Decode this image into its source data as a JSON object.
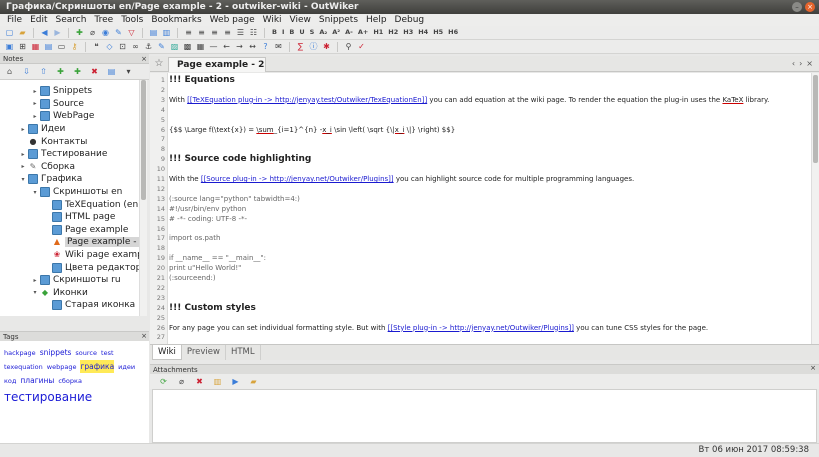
{
  "window": {
    "title": "Графика/Скриншоты en/Page example - 2 - outwiker-wiki - OutWiker"
  },
  "menu": [
    "File",
    "Edit",
    "Search",
    "Tree",
    "Tools",
    "Bookmarks",
    "Web page",
    "Wiki",
    "View",
    "Snippets",
    "Help",
    "Debug"
  ],
  "toolbar": {
    "format_labels": [
      "B",
      "I",
      "B",
      "U",
      "S",
      "A₂",
      "A²",
      "A-",
      "A+",
      "H1",
      "H2",
      "H3",
      "H4",
      "H5",
      "H6"
    ]
  },
  "notes_panel": {
    "title": "Notes",
    "tree": [
      {
        "label": "Snippets",
        "depth": 2,
        "arrow": "▸",
        "icon": "page"
      },
      {
        "label": "Source",
        "depth": 2,
        "arrow": "▸",
        "icon": "page"
      },
      {
        "label": "WebPage",
        "depth": 2,
        "arrow": "▸",
        "icon": "page"
      },
      {
        "label": "Идеи",
        "depth": 1,
        "arrow": "▸",
        "icon": "page"
      },
      {
        "label": "Контакты",
        "depth": 1,
        "arrow": "",
        "icon": "person"
      },
      {
        "label": "Тестирование",
        "depth": 1,
        "arrow": "▸",
        "icon": "page"
      },
      {
        "label": "Сборка",
        "depth": 1,
        "arrow": "▸",
        "icon": "wrench"
      },
      {
        "label": "Графика",
        "depth": 1,
        "arrow": "▾",
        "icon": "page"
      },
      {
        "label": "Скриншоты en",
        "depth": 2,
        "arrow": "▾",
        "icon": "page"
      },
      {
        "label": "TeXEquation (en)",
        "depth": 3,
        "arrow": "",
        "icon": "page"
      },
      {
        "label": "HTML page",
        "depth": 3,
        "arrow": "",
        "icon": "page"
      },
      {
        "label": "Page example",
        "depth": 3,
        "arrow": "",
        "icon": "page"
      },
      {
        "label": "Page example - 2",
        "depth": 3,
        "arrow": "",
        "icon": "warning",
        "selected": true
      },
      {
        "label": "Wiki page example",
        "depth": 3,
        "arrow": "",
        "icon": "wiki"
      },
      {
        "label": "Цвета редактора",
        "depth": 3,
        "arrow": "",
        "icon": "page"
      },
      {
        "label": "Скриншоты ru",
        "depth": 2,
        "arrow": "▸",
        "icon": "page"
      },
      {
        "label": "Иконки",
        "depth": 2,
        "arrow": "▾",
        "icon": "images"
      },
      {
        "label": "Старая иконка",
        "depth": 3,
        "arrow": "",
        "icon": "page"
      }
    ]
  },
  "tags_panel": {
    "title": "Tags",
    "tags": [
      {
        "label": "hackpage",
        "size": "sm"
      },
      {
        "label": "snippets",
        "size": "md"
      },
      {
        "label": "source",
        "size": "sm"
      },
      {
        "label": "test",
        "size": "sm"
      },
      {
        "label": "texequation",
        "size": "sm"
      },
      {
        "label": "webpage",
        "size": "sm"
      },
      {
        "label": "графика",
        "size": "md",
        "highlight": true
      },
      {
        "label": "идеи",
        "size": "sm"
      },
      {
        "label": "код",
        "size": "sm"
      },
      {
        "label": "плагины",
        "size": "md"
      },
      {
        "label": "сборка",
        "size": "sm"
      },
      {
        "label": "тестирование",
        "size": "lg"
      }
    ]
  },
  "editor": {
    "tab_label": "Page example - 2",
    "tab_close": "×",
    "right_controls": [
      "‹",
      "›",
      "×"
    ],
    "lines": [
      {
        "n": "1",
        "segs": [
          {
            "t": "!!! Equations",
            "s": "h"
          }
        ]
      },
      {
        "n": "2",
        "segs": []
      },
      {
        "n": "3",
        "segs": [
          {
            "t": "With "
          },
          {
            "t": "[[TeXEquation plug-in -> http://jenyay.test/Outwiker/TexEquationEn]]",
            "s": "link"
          },
          {
            "t": " you can add equation at the wiki page. To render the equation the plug-in uses the "
          },
          {
            "t": "KaTeX",
            "s": "uline"
          },
          {
            "t": " library."
          }
        ]
      },
      {
        "n": "4",
        "segs": []
      },
      {
        "n": "5",
        "segs": []
      },
      {
        "n": "6",
        "segs": [
          {
            "t": "{$$ \\Large f(\\text{x}) = "
          },
          {
            "t": "\\sum",
            "s": "uline"
          },
          {
            "t": "_{i=1}^{n} -"
          },
          {
            "t": "x_i",
            "s": "uline"
          },
          {
            "t": " \\sin \\left( \\sqrt {\\"
          },
          {
            "t": "|x_i",
            "s": "uline"
          },
          {
            "t": " \\|} \\right) $$}"
          }
        ]
      },
      {
        "n": "7",
        "segs": []
      },
      {
        "n": "8",
        "segs": []
      },
      {
        "n": "9",
        "segs": [
          {
            "t": "!!! Source code highlighting",
            "s": "h"
          }
        ]
      },
      {
        "n": "10",
        "segs": []
      },
      {
        "n": "11",
        "segs": [
          {
            "t": "With the "
          },
          {
            "t": "[[Source plug-in -> http://jenyay.net/Outwiker/Plugins]]",
            "s": "link"
          },
          {
            "t": " you can highlight source code for multiple programming languages."
          }
        ]
      },
      {
        "n": "12",
        "segs": []
      },
      {
        "n": "13",
        "segs": [
          {
            "t": "(:source lang=\"python\" tabwidth=4:)",
            "s": "muted"
          }
        ]
      },
      {
        "n": "14",
        "segs": [
          {
            "t": "#!/usr/bin/env python",
            "s": "muted"
          }
        ]
      },
      {
        "n": "15",
        "segs": [
          {
            "t": "# -*- coding: UTF-8 -*-",
            "s": "muted"
          }
        ]
      },
      {
        "n": "16",
        "segs": []
      },
      {
        "n": "17",
        "segs": [
          {
            "t": "import os.path",
            "s": "muted"
          }
        ]
      },
      {
        "n": "18",
        "segs": []
      },
      {
        "n": "19",
        "segs": [
          {
            "t": "if __name__ == \"__main__\":",
            "s": "muted"
          }
        ]
      },
      {
        "n": "20",
        "segs": [
          {
            "t": "    print u\"Hello World!\"",
            "s": "muted"
          }
        ]
      },
      {
        "n": "21",
        "segs": [
          {
            "t": "(:sourceend:)",
            "s": "muted"
          }
        ]
      },
      {
        "n": "22",
        "segs": []
      },
      {
        "n": "23",
        "segs": []
      },
      {
        "n": "24",
        "segs": [
          {
            "t": "!!! Custom styles",
            "s": "h"
          }
        ]
      },
      {
        "n": "25",
        "segs": []
      },
      {
        "n": "26",
        "segs": [
          {
            "t": "For any page you can set individual formatting style. But with "
          },
          {
            "t": "[[Style plug-in -> http://jenyay.net/Outwiker/Plugins]]",
            "s": "link"
          },
          {
            "t": " you can tune CSS styles for the page."
          }
        ]
      },
      {
        "n": "27",
        "segs": []
      }
    ]
  },
  "mode_tabs": [
    {
      "label": "Wiki",
      "active": true
    },
    {
      "label": "Preview",
      "active": false
    },
    {
      "label": "HTML",
      "active": false
    }
  ],
  "attachments": {
    "title": "Attachments"
  },
  "status": {
    "datetime": "Вт 06 июн 2017 08:59:38"
  }
}
